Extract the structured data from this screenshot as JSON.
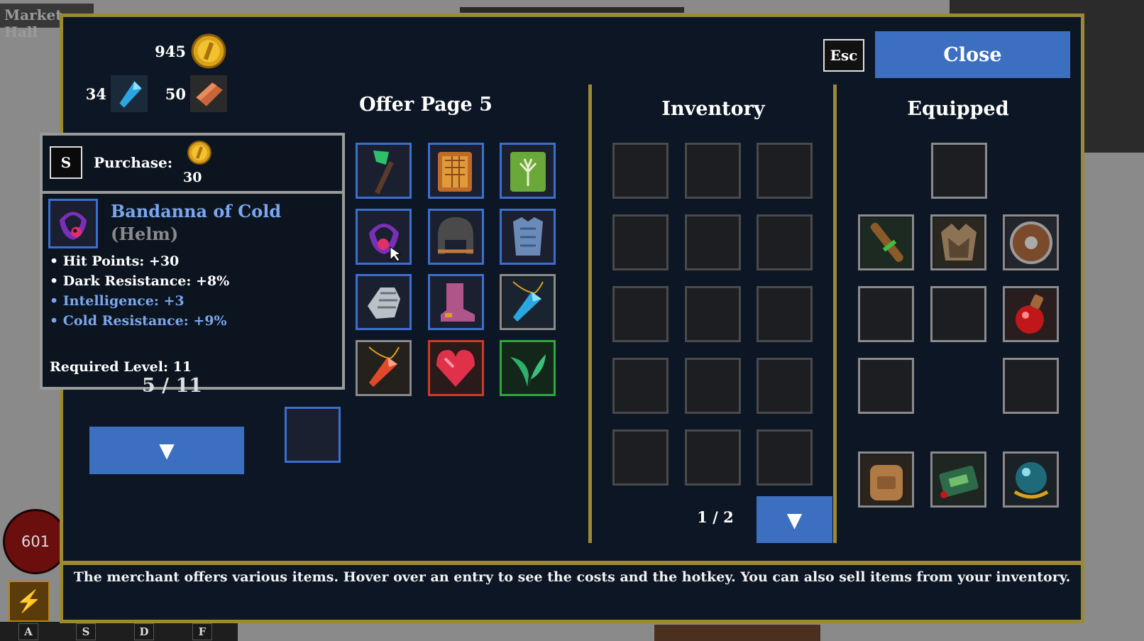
{
  "background": {
    "market_label": "Market Hall"
  },
  "hud": {
    "hp_value": "601",
    "hotkeys": [
      "A",
      "S",
      "D",
      "F"
    ]
  },
  "currency": {
    "gold": "945",
    "crystals": "34",
    "copper": "50"
  },
  "header": {
    "esc_label": "Esc",
    "close_label": "Close"
  },
  "offer": {
    "title": "Offer Page 5",
    "items": [
      {
        "name": "emerald-staff",
        "rarity": "blue"
      },
      {
        "name": "orange-tome",
        "rarity": "blue"
      },
      {
        "name": "green-tree-tome",
        "rarity": "blue"
      },
      {
        "name": "bandanna-of-cold",
        "rarity": "blue"
      },
      {
        "name": "iron-helm",
        "rarity": "blue"
      },
      {
        "name": "blue-chestplate",
        "rarity": "blue"
      },
      {
        "name": "steel-gauntlet",
        "rarity": "blue"
      },
      {
        "name": "pink-boots",
        "rarity": "blue"
      },
      {
        "name": "blue-crystal-amulet",
        "rarity": "grey"
      },
      {
        "name": "red-crystal-amulet",
        "rarity": "grey"
      },
      {
        "name": "ruby-heart",
        "rarity": "red"
      },
      {
        "name": "green-leaves",
        "rarity": "green"
      }
    ]
  },
  "inventory": {
    "title": "Inventory",
    "page": "1 / 2"
  },
  "equipped": {
    "title": "Equipped"
  },
  "tooltip": {
    "hotkey": "S",
    "purchase_label": "Purchase:",
    "cost": "30",
    "item_name": "Bandanna of Cold",
    "item_type": "(Helm)",
    "stats": [
      {
        "text": "• Hit Points: +30",
        "color": "white"
      },
      {
        "text": "• Dark Resistance: +8%",
        "color": "white"
      },
      {
        "text": "• Intelligence: +3",
        "color": "blue"
      },
      {
        "text": "• Cold Resistance: +9%",
        "color": "blue"
      }
    ],
    "required_level": "Required Level: 11"
  },
  "left_panel": {
    "level_text": "5 / 11"
  },
  "footer": {
    "text": "The merchant offers various items. Hover over an entry to see the costs and the hotkey. You can also sell items from your inventory."
  },
  "colors": {
    "panel_bg": "#0d1624",
    "gold_border": "#9b8a33",
    "button_blue": "#3d6fc0",
    "rarity_blue": "#3b6fcf",
    "rarity_red": "#cc3a2a",
    "rarity_green": "#2fa83a",
    "magic_text": "#7aa7ec"
  }
}
